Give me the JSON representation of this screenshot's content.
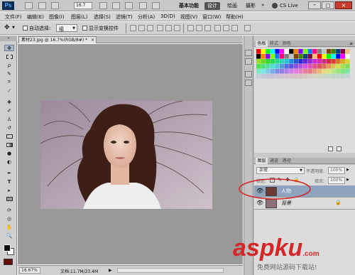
{
  "app": {
    "logo": "Ps",
    "zoom_value": "16.7",
    "cs_live": "CS Live"
  },
  "workspaces": [
    {
      "label": "基本功能",
      "active": false
    },
    {
      "label": "设计",
      "active": true
    },
    {
      "label": "绘画",
      "active": false
    },
    {
      "label": "摄影",
      "active": false
    }
  ],
  "menu": [
    "文件(F)",
    "编辑(E)",
    "图像(I)",
    "图层(L)",
    "选择(S)",
    "滤镜(T)",
    "分析(A)",
    "3D(D)",
    "视图(V)",
    "窗口(W)",
    "帮助(H)"
  ],
  "options_bar": {
    "auto_select_label": "自动选择:",
    "auto_select_value": "组",
    "transform_label": "显示变换控件"
  },
  "document": {
    "tab_title": "素材23.jpg @ 16.7%(RGB/8#) *",
    "zoom_readout": "16.67%",
    "doc_info": "文档:11.7M/23.4M"
  },
  "swatches_panel": {
    "tabs": [
      "色板",
      "样式",
      "颜色"
    ]
  },
  "layers_panel": {
    "tabs": [
      "图层",
      "通道",
      "路径"
    ],
    "blend_mode": "正常",
    "opacity_label": "不透明度:",
    "opacity_value": "100%",
    "lock_label": "锁定:",
    "fill_label": "填充:",
    "fill_value": "100%",
    "layers": [
      {
        "name": "人物",
        "selected": true
      },
      {
        "name": "背景",
        "selected": false
      }
    ]
  },
  "watermark": {
    "main": "aspku",
    "suffix": ".com",
    "sub": "免费网站源码下载站!"
  },
  "colors": {
    "accent": "#d42727",
    "swatch_palette": [
      "#ff0000",
      "#ffff00",
      "#00ff00",
      "#00ffff",
      "#0000ff",
      "#ff00ff",
      "#ffffff",
      "#000000",
      "#ff8000",
      "#8000ff",
      "#80ff00",
      "#0080ff",
      "#ff0080",
      "#808080",
      "#c0c0c0",
      "#804000",
      "#408000",
      "#004080",
      "#800040",
      "#f0c080"
    ]
  }
}
